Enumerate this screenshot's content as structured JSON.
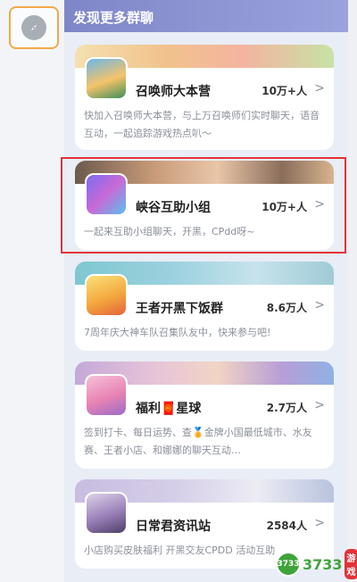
{
  "panel": {
    "title": "发现更多群聊"
  },
  "groups": [
    {
      "name": "召唤师大本营",
      "members": "10万+人",
      "description": "快加入召唤师大本营，与上万召唤师们实时聊天，语音互动，一起追踪游戏热点叭～"
    },
    {
      "name": "峡谷互助小组",
      "members": "10万+人",
      "description": "一起来互助小组聊天，开黑，CPdd呀~"
    },
    {
      "name": "王者开黑下饭群",
      "members": "8.6万人",
      "description": "7周年庆大神车队召集队友中，快来参与吧!"
    },
    {
      "name": "福利🧧星球",
      "members": "2.7万人",
      "description": "签到打卡、每日运势、查🏅金牌小国最低城市、水友赛、王者小店、和娜娜的聊天互动…"
    },
    {
      "name": "日常君资讯站",
      "members": "2584人",
      "description": "小店购买皮肤福利 开黑交友CPDD 活动互助"
    }
  ],
  "chevron": ">",
  "icons": {
    "compass": "compass-icon"
  },
  "watermark": {
    "logo": "3733",
    "text": "3733",
    "badge": "游戏"
  },
  "colors": {
    "accent": "#7f86c8",
    "highlight": "#e2333a",
    "selected": "#f0a94a"
  }
}
